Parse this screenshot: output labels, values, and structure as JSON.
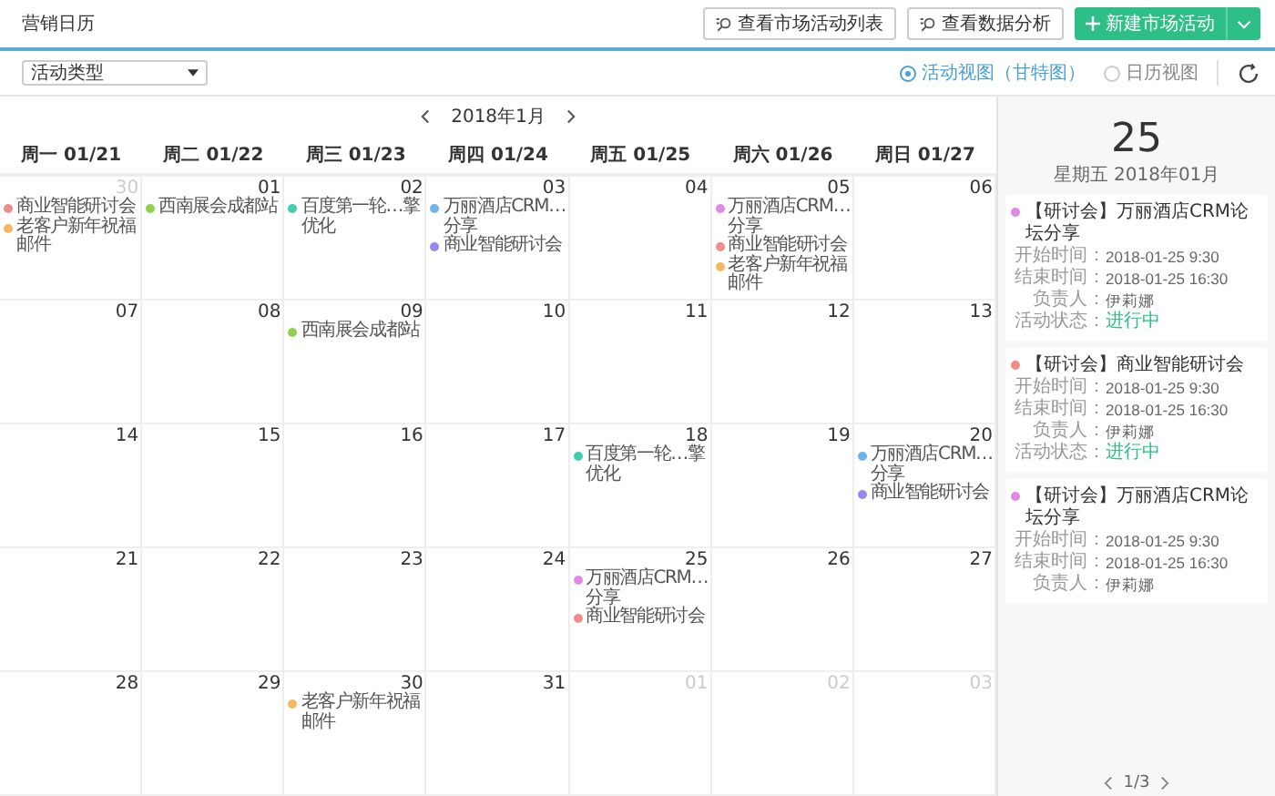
{
  "header": {
    "title": "营销日历",
    "buttons": [
      {
        "label": "查看市场活动列表",
        "kind": "outline"
      },
      {
        "label": "查看数据分析",
        "kind": "outline"
      },
      {
        "label": "新建市场活动",
        "kind": "primary"
      }
    ]
  },
  "toolbar": {
    "filter": {
      "value": "活动类型"
    },
    "views": [
      {
        "label": "活动视图（甘特图）",
        "selected": true
      },
      {
        "label": "日历视图",
        "selected": false
      }
    ]
  },
  "calendar": {
    "month": "2018年1月",
    "weekdays": [
      "周一 01/21",
      "周二 01/22",
      "周三 01/23",
      "周四 01/24",
      "周五 01/25",
      "周六 01/26",
      "周日 01/27"
    ],
    "weeks": [
      [
        {
          "day": "30",
          "muted": true,
          "events": [
            {
              "label": "商业智能研讨会",
              "color": "#f08c8c"
            },
            {
              "label": "老客户新年祝福邮件",
              "color": "#f5b860"
            }
          ]
        },
        {
          "day": "01",
          "muted": false,
          "events": [
            {
              "label": "西南展会成都站",
              "color": "#8fd150"
            }
          ]
        },
        {
          "day": "02",
          "muted": false,
          "events": [
            {
              "label": "百度第一轮…擎优化",
              "color": "#40cfae"
            }
          ]
        },
        {
          "day": "03",
          "muted": false,
          "events": [
            {
              "label": "万丽酒店CRM…分享",
              "color": "#6cb4f0"
            },
            {
              "label": "商业智能研讨会",
              "color": "#9b87f0"
            }
          ]
        },
        {
          "day": "04",
          "muted": false
        },
        {
          "day": "05",
          "muted": false,
          "events": [
            {
              "label": "万丽酒店CRM…分享",
              "color": "#e08ae8"
            },
            {
              "label": "商业智能研讨会",
              "color": "#f08c8c"
            },
            {
              "label": "老客户新年祝福邮件",
              "color": "#f5b860"
            }
          ]
        },
        {
          "day": "06",
          "muted": false
        }
      ],
      [
        {
          "day": "07",
          "muted": false
        },
        {
          "day": "08",
          "muted": false
        },
        {
          "day": "09",
          "muted": false,
          "events": [
            {
              "label": "西南展会成都站",
              "color": "#8fd150"
            }
          ]
        },
        {
          "day": "10",
          "muted": false
        },
        {
          "day": "11",
          "muted": false
        },
        {
          "day": "12",
          "muted": false
        },
        {
          "day": "13",
          "muted": false
        }
      ],
      [
        {
          "day": "14",
          "muted": false
        },
        {
          "day": "15",
          "muted": false
        },
        {
          "day": "16",
          "muted": false
        },
        {
          "day": "17",
          "muted": false
        },
        {
          "day": "18",
          "muted": false,
          "events": [
            {
              "label": "百度第一轮…擎优化",
              "color": "#40cfae"
            }
          ]
        },
        {
          "day": "19",
          "muted": false
        },
        {
          "day": "20",
          "muted": false,
          "events": [
            {
              "label": "万丽酒店CRM…分享",
              "color": "#6cb4f0"
            },
            {
              "label": "商业智能研讨会",
              "color": "#9b87f0"
            }
          ]
        }
      ],
      [
        {
          "day": "21",
          "muted": false
        },
        {
          "day": "22",
          "muted": false
        },
        {
          "day": "23",
          "muted": false
        },
        {
          "day": "24",
          "muted": false
        },
        {
          "day": "25",
          "muted": false,
          "events": [
            {
              "label": "万丽酒店CRM…分享",
              "color": "#e08ae8"
            },
            {
              "label": "商业智能研讨会",
              "color": "#f08c8c"
            }
          ]
        },
        {
          "day": "26",
          "muted": false
        },
        {
          "day": "27",
          "muted": false
        }
      ],
      [
        {
          "day": "28",
          "muted": false
        },
        {
          "day": "29",
          "muted": false
        },
        {
          "day": "30",
          "muted": false,
          "events": [
            {
              "label": "老客户新年祝福邮件",
              "color": "#f5b860"
            }
          ]
        },
        {
          "day": "31",
          "muted": false
        },
        {
          "day": "01",
          "muted": true
        },
        {
          "day": "02",
          "muted": true
        },
        {
          "day": "03",
          "muted": true
        }
      ]
    ]
  },
  "detail": {
    "day": "25",
    "subtitle": "星期五 2018年01月",
    "pager": "1/3",
    "events": [
      {
        "title": "【研讨会】万丽酒店CRM论坛分享",
        "color": "#e08ae8",
        "fields": [
          {
            "label": "开始时间：",
            "value": "2018-01-25  9:30"
          },
          {
            "label": "结束时间：",
            "value": "2018-01-25  16:30"
          },
          {
            "label": "负责人：",
            "value": "伊莉娜"
          }
        ],
        "status": {
          "label": "活动状态：",
          "value": "进行中"
        }
      },
      {
        "title": "【研讨会】商业智能研讨会",
        "color": "#f08c8c",
        "fields": [
          {
            "label": "开始时间：",
            "value": "2018-01-25  9:30"
          },
          {
            "label": "结束时间：",
            "value": "2018-01-25  16:30"
          },
          {
            "label": "负责人：",
            "value": "伊莉娜"
          }
        ],
        "status": {
          "label": "活动状态：",
          "value": "进行中"
        }
      },
      {
        "title": "【研讨会】万丽酒店CRM论坛分享",
        "color": "#e08ae8",
        "fields": [
          {
            "label": "开始时间：",
            "value": "2018-01-25  9:30"
          },
          {
            "label": "结束时间：",
            "value": "2018-01-25  16:30"
          },
          {
            "label": "负责人：",
            "value": "伊莉娜"
          }
        ]
      }
    ]
  }
}
